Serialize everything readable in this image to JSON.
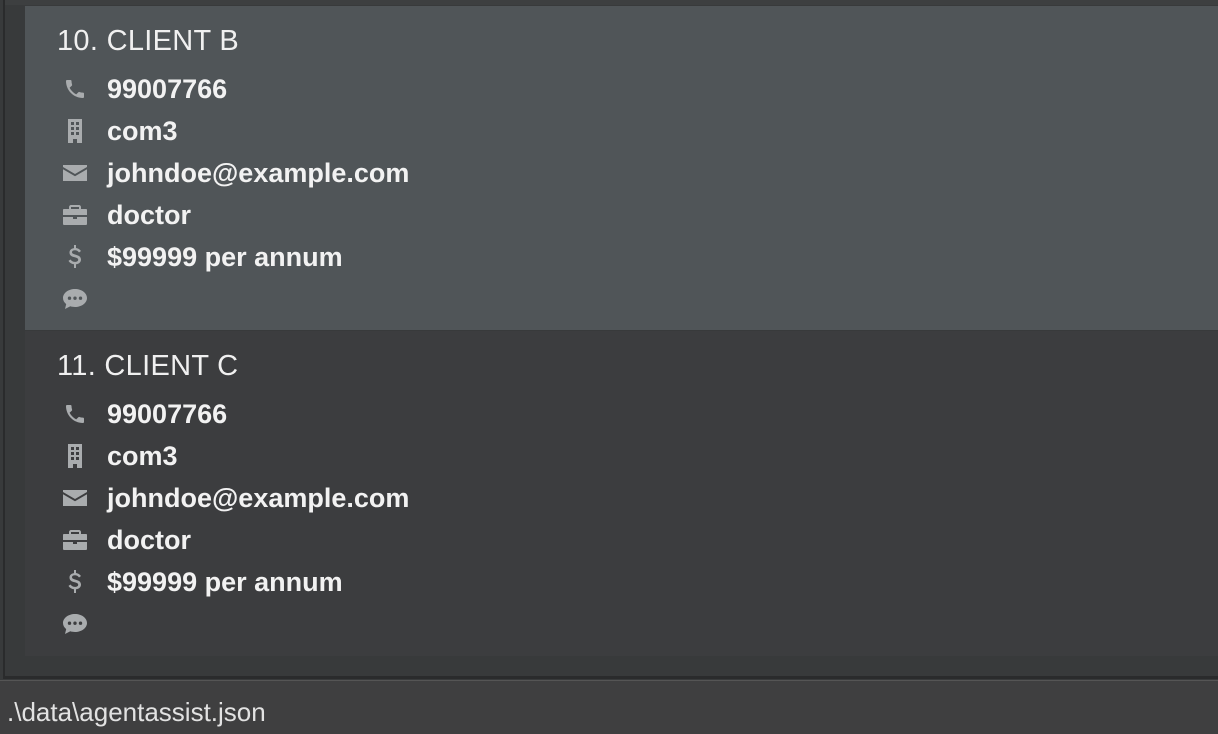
{
  "colors": {
    "selected_card_bg": "#505558",
    "card_bg": "#3c3d3f",
    "icon_color": "#a9acae",
    "text_color": "#f2f2f2",
    "status_bar_bg": "#3f3f40"
  },
  "clients": [
    {
      "title": "10. CLIENT B",
      "selected": true,
      "phone": "99007766",
      "company": "com3",
      "email": "johndoe@example.com",
      "occupation": "doctor",
      "salary": "$99999 per annum",
      "remark": "",
      "icons": [
        "phone-icon",
        "building-icon",
        "envelope-icon",
        "briefcase-icon",
        "dollar-icon",
        "comment-icon"
      ]
    },
    {
      "title": "11. CLIENT C",
      "selected": false,
      "phone": "99007766",
      "company": "com3",
      "email": "johndoe@example.com",
      "occupation": "doctor",
      "salary": "$99999 per annum",
      "remark": "",
      "icons": [
        "phone-icon",
        "building-icon",
        "envelope-icon",
        "briefcase-icon",
        "dollar-icon",
        "comment-icon"
      ]
    }
  ],
  "status_bar": {
    "file_path": ".\\data\\agentassist.json"
  }
}
